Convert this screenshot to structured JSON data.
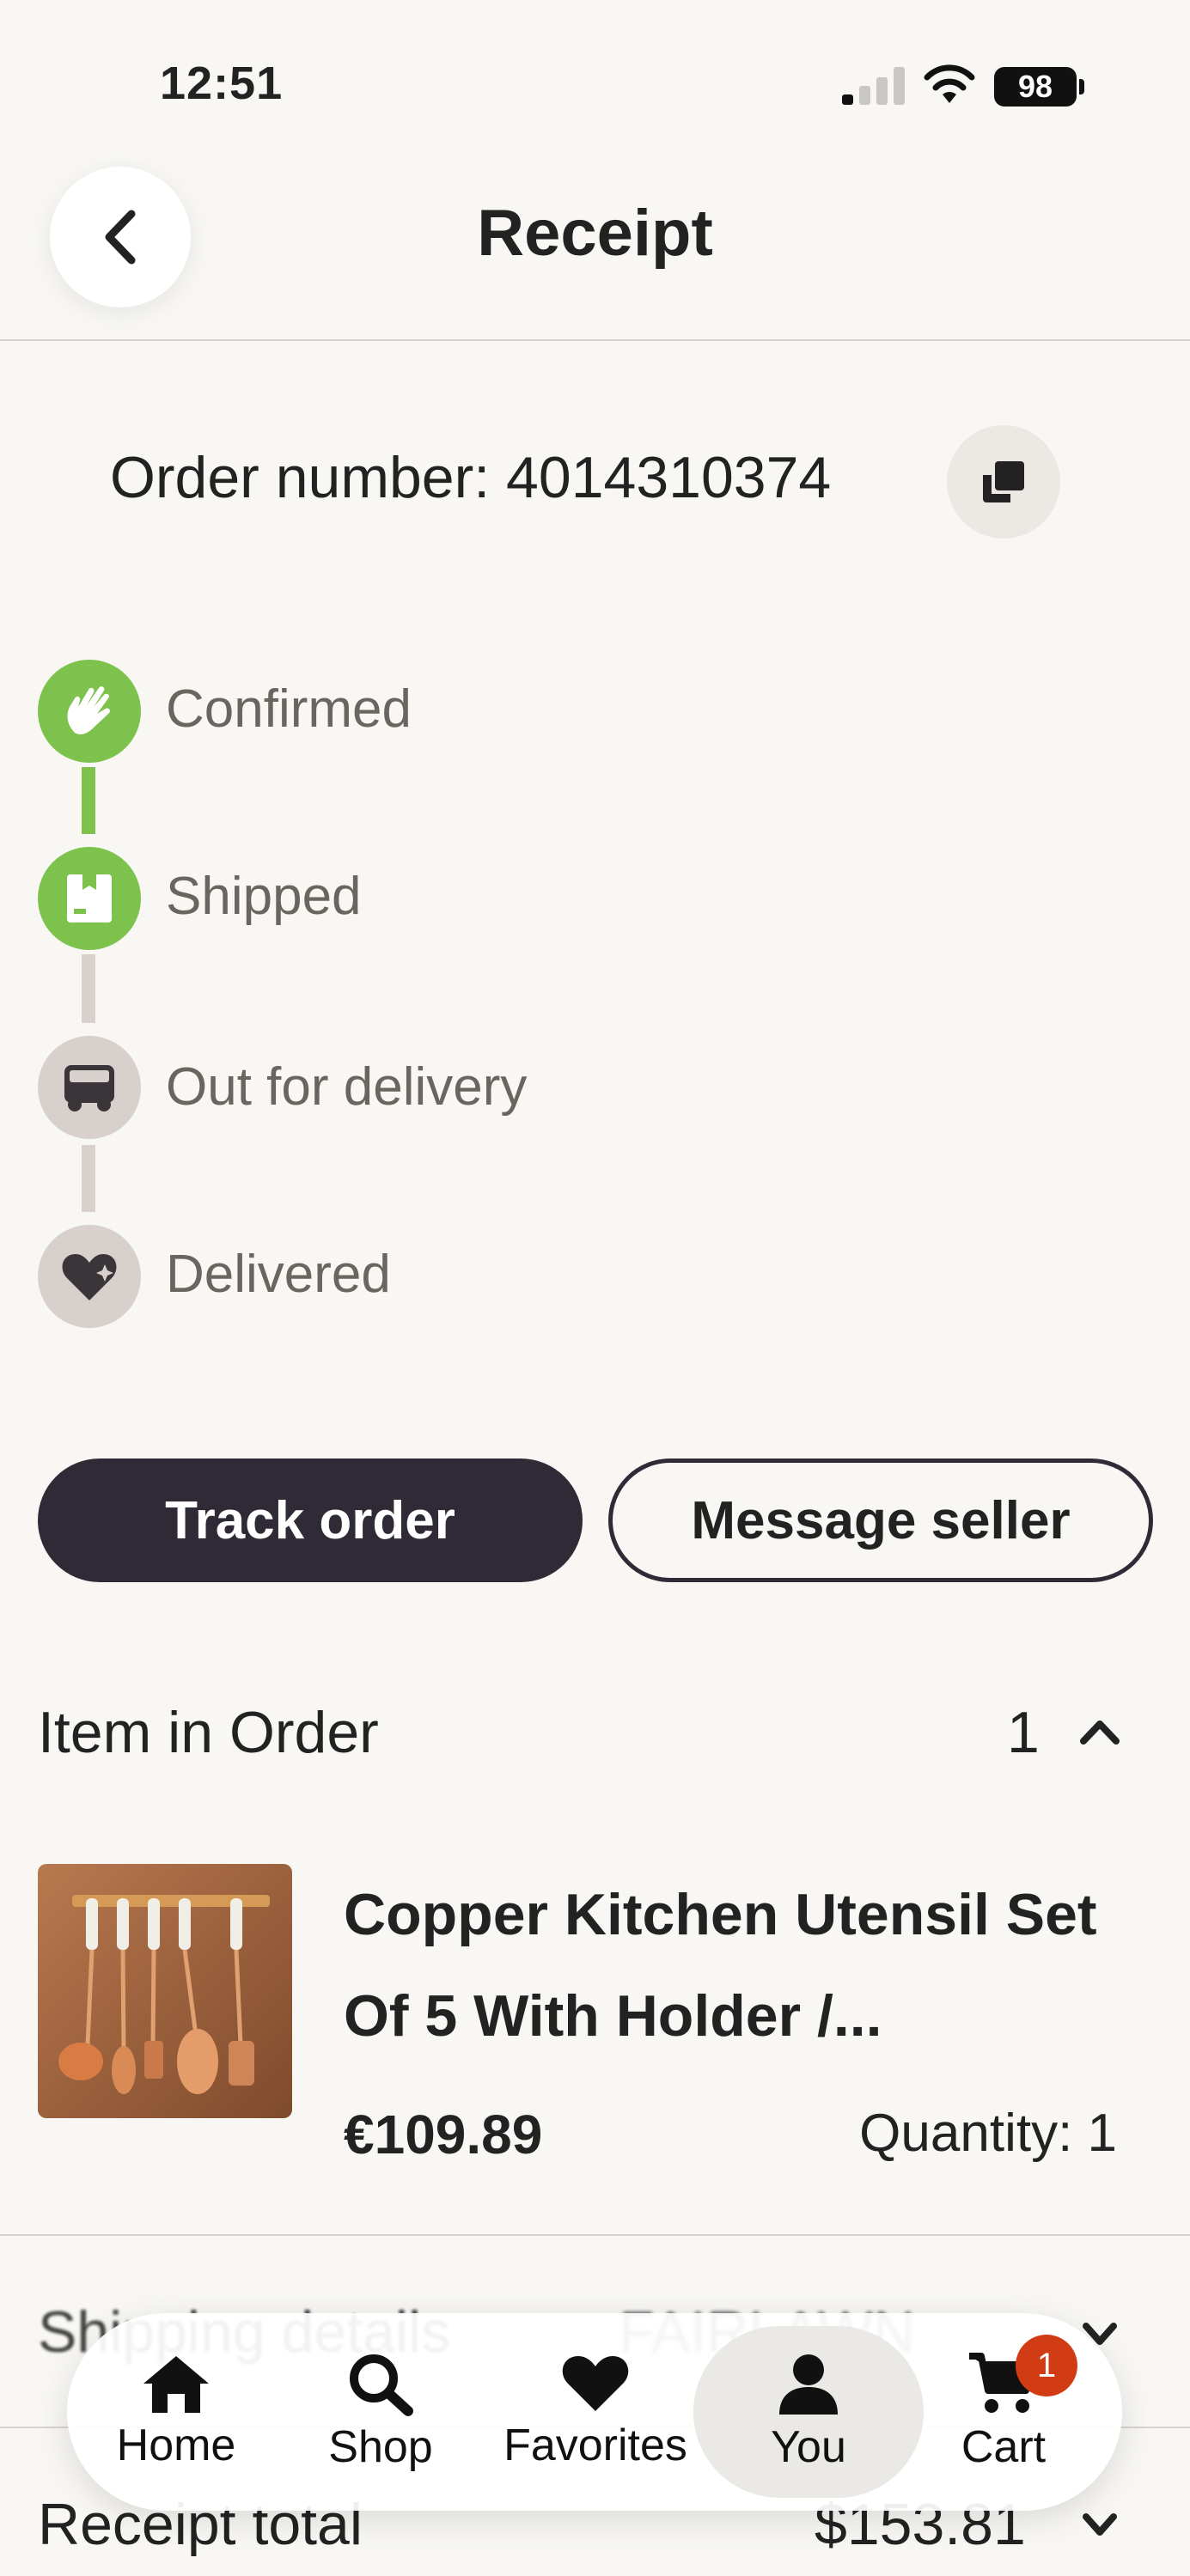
{
  "status_bar": {
    "time": "12:51",
    "battery": "98"
  },
  "header": {
    "title": "Receipt"
  },
  "order": {
    "number_text": "Order number: 4014310374"
  },
  "timeline": [
    {
      "label": "Confirmed",
      "state": "done",
      "icon": "hand-wave-icon"
    },
    {
      "label": "Shipped",
      "state": "done",
      "icon": "package-icon"
    },
    {
      "label": "Out for delivery",
      "state": "pending",
      "icon": "truck-icon"
    },
    {
      "label": "Delivered",
      "state": "pending",
      "icon": "heart-sparkle-icon"
    }
  ],
  "actions": {
    "track_label": "Track order",
    "message_label": "Message seller"
  },
  "items_section": {
    "label": "Item in Order",
    "count": "1",
    "product": {
      "title": "Copper Kitchen Utensil Set Of 5 With Holder /...",
      "price": "€109.89",
      "quantity": "Quantity: 1"
    }
  },
  "shipping": {
    "label": "Shipping details",
    "value": "FAIRLAWN"
  },
  "total": {
    "label": "Receipt total",
    "value": "$153.81"
  },
  "tabbar": {
    "home": "Home",
    "shop": "Shop",
    "favorites": "Favorites",
    "you": "You",
    "cart": "Cart",
    "cart_badge": "1"
  },
  "colors": {
    "accent_green": "#7dc24d",
    "pending_gray": "#d8d0cc",
    "primary_button": "#2f2a36",
    "badge_red": "#d23c14",
    "background": "#f8f7f4"
  }
}
